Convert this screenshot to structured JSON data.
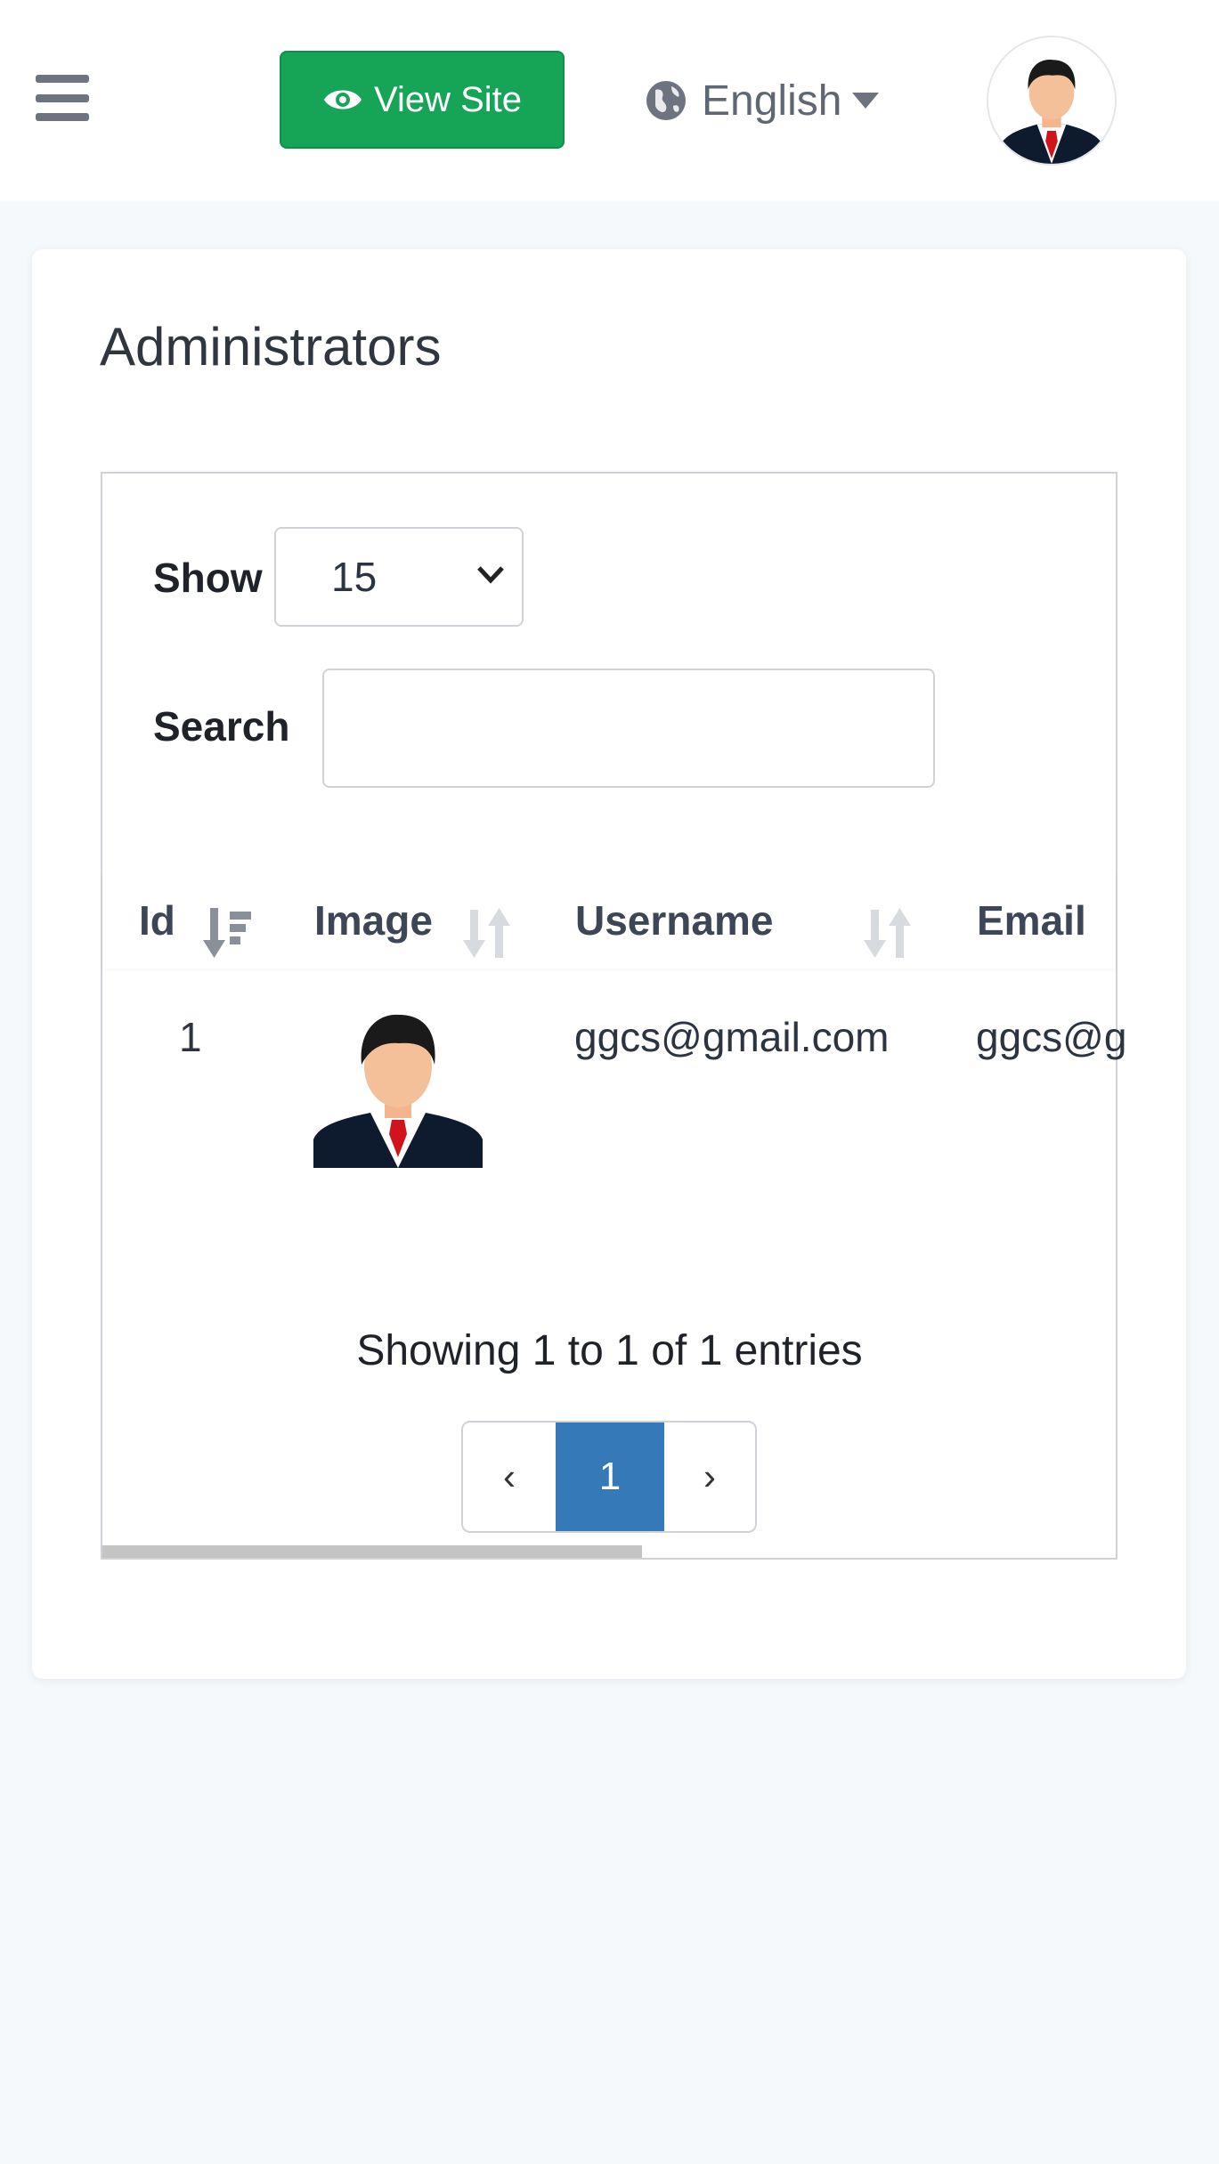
{
  "header": {
    "view_site_label": "View Site",
    "language": "English",
    "icons": [
      "hamburger-icon",
      "eye-icon",
      "globe-icon",
      "caret-down-icon",
      "avatar"
    ]
  },
  "page": {
    "title": "Administrators"
  },
  "table_controls": {
    "show_label": "Show",
    "show_value": "15",
    "search_label": "Search",
    "search_value": ""
  },
  "table": {
    "columns": [
      "Id",
      "Image",
      "Username",
      "Email"
    ],
    "rows": [
      {
        "id": "1",
        "username": "ggcs@gmail.com",
        "email": "ggcs@g"
      }
    ]
  },
  "footer": {
    "info": "Showing 1 to 1 of 1 entries",
    "pagination": {
      "prev": "‹",
      "current": "1",
      "next": "›"
    }
  },
  "colors": {
    "view_site_bg": "#16a556",
    "active_page_bg": "#3579b8",
    "page_bg": "#f6f9fb"
  }
}
